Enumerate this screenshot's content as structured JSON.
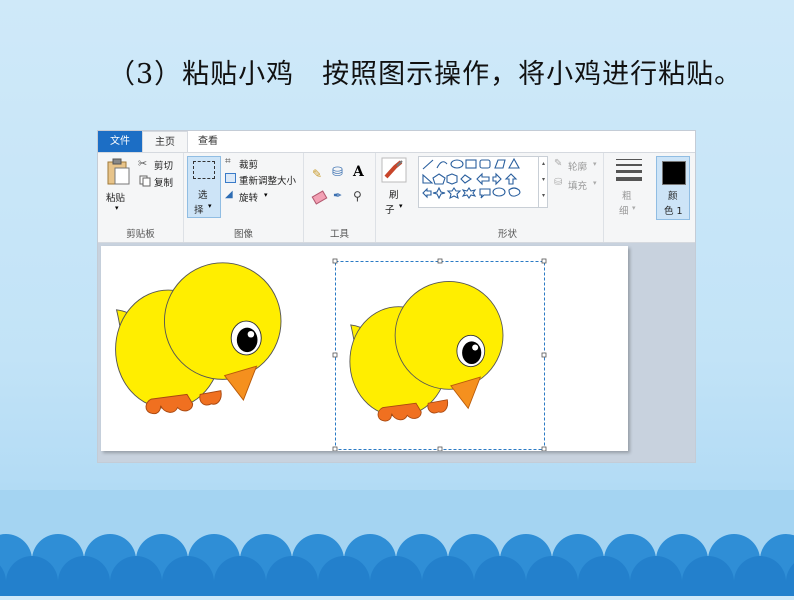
{
  "slide": {
    "text": "（3）粘贴小鸡　按照图示操作，将小鸡进行粘贴。"
  },
  "paint": {
    "tabs": {
      "file": "文件",
      "home": "主页",
      "view": "查看"
    },
    "clipboard": {
      "paste": "粘贴",
      "cut": "剪切",
      "copy": "复制",
      "group_label": "剪贴板"
    },
    "image": {
      "select_top": "选",
      "select_bottom": "择",
      "crop": "裁剪",
      "resize": "重新调整大小",
      "rotate": "旋转",
      "group_label": "图像"
    },
    "tools": {
      "group_label": "工具"
    },
    "brush": {
      "top": "刷",
      "bottom": "子"
    },
    "shapes": {
      "outline": "轮廓",
      "fill": "填充",
      "group_label": "形状"
    },
    "size": {
      "top": "粗",
      "bottom": "细"
    },
    "color": {
      "top": "颜",
      "bottom": "色 1",
      "value": "#000000"
    }
  },
  "colors": {
    "accent": "#1c6ec5",
    "chick_body": "#ffee00",
    "beak": "#f5901e",
    "feet": "#f07020",
    "wave": "#2f8ed6"
  }
}
